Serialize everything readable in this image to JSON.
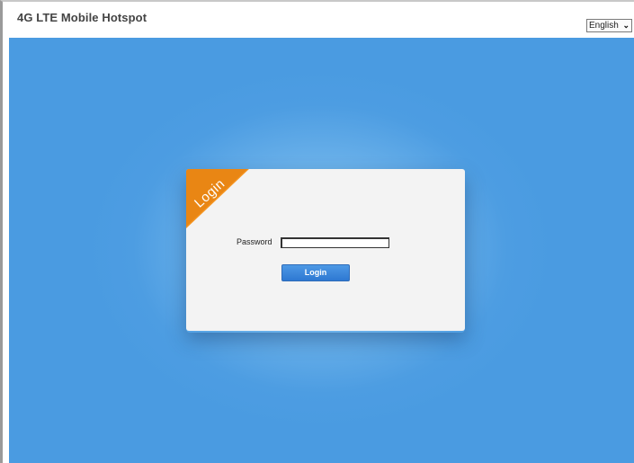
{
  "header": {
    "title": "4G LTE Mobile Hotspot",
    "language": {
      "selected": "English",
      "icon": "chevron-down-icon"
    }
  },
  "login": {
    "ribbon_label": "Login",
    "password_label": "Password",
    "password_value": "",
    "login_button": "Login"
  },
  "colors": {
    "background_blue": "#4a9be1",
    "panel": "#f3f3f3",
    "ribbon_orange": "#f49420",
    "button_blue": "#3a86d9"
  }
}
